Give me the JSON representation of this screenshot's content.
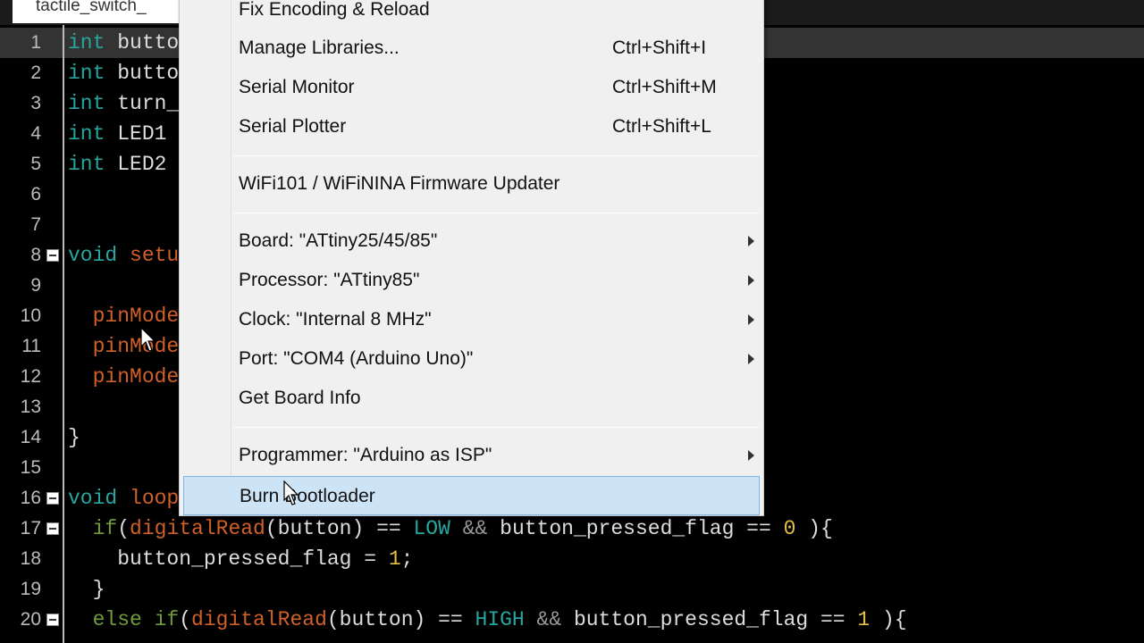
{
  "tab": {
    "title": "tactile_switch_"
  },
  "editor": {
    "lines": [
      {
        "n": "1",
        "fold": false,
        "hl": true,
        "t": [
          [
            "int",
            "kw"
          ],
          [
            " butto",
            "tx"
          ]
        ]
      },
      {
        "n": "2",
        "fold": false,
        "t": [
          [
            "int",
            "kw"
          ],
          [
            " butto",
            "tx"
          ]
        ]
      },
      {
        "n": "3",
        "fold": false,
        "t": [
          [
            "int",
            "kw"
          ],
          [
            " turn_",
            "tx"
          ]
        ]
      },
      {
        "n": "4",
        "fold": false,
        "t": [
          [
            "int",
            "kw"
          ],
          [
            " LED1",
            "tx"
          ]
        ]
      },
      {
        "n": "5",
        "fold": false,
        "t": [
          [
            "int",
            "kw"
          ],
          [
            " LED2",
            "tx"
          ]
        ]
      },
      {
        "n": "6",
        "fold": false,
        "t": []
      },
      {
        "n": "7",
        "fold": false,
        "t": []
      },
      {
        "n": "8",
        "fold": true,
        "t": [
          [
            "void",
            "kw"
          ],
          [
            " setu",
            "fn"
          ]
        ]
      },
      {
        "n": "9",
        "fold": false,
        "t": []
      },
      {
        "n": "10",
        "fold": false,
        "t": [
          [
            "  pinMode",
            "fn"
          ]
        ]
      },
      {
        "n": "11",
        "fold": false,
        "t": [
          [
            "  pinMode",
            "fn"
          ]
        ]
      },
      {
        "n": "12",
        "fold": false,
        "t": [
          [
            "  pinMode",
            "fn"
          ]
        ]
      },
      {
        "n": "13",
        "fold": false,
        "t": []
      },
      {
        "n": "14",
        "fold": false,
        "t": [
          [
            "}",
            "tx"
          ]
        ]
      },
      {
        "n": "15",
        "fold": false,
        "t": []
      },
      {
        "n": "16",
        "fold": true,
        "t": [
          [
            "void",
            "kw"
          ],
          [
            " loop",
            "fn"
          ]
        ]
      },
      {
        "n": "17",
        "fold": true,
        "t": [
          [
            "  if",
            "kw2"
          ],
          [
            "(",
            "tx"
          ],
          [
            "digitalRead",
            "fn"
          ],
          [
            "(button) == ",
            "tx"
          ],
          [
            "LOW",
            "ct"
          ],
          [
            " && ",
            "op"
          ],
          [
            "button_pressed_flag == ",
            "tx"
          ],
          [
            "0",
            "num"
          ],
          [
            " ){",
            "tx"
          ]
        ]
      },
      {
        "n": "18",
        "fold": false,
        "t": [
          [
            "    button_pressed_flag = ",
            "tx"
          ],
          [
            "1",
            "num"
          ],
          [
            ";",
            "tx"
          ]
        ]
      },
      {
        "n": "19",
        "fold": false,
        "t": [
          [
            "  }",
            "tx"
          ]
        ]
      },
      {
        "n": "20",
        "fold": true,
        "t": [
          [
            "  else if",
            "kw2"
          ],
          [
            "(",
            "tx"
          ],
          [
            "digitalRead",
            "fn"
          ],
          [
            "(button) == ",
            "tx"
          ],
          [
            "HIGH",
            "ct"
          ],
          [
            " && ",
            "op"
          ],
          [
            "button_pressed_flag == ",
            "tx"
          ],
          [
            "1",
            "num"
          ],
          [
            " ){",
            "tx"
          ]
        ]
      }
    ]
  },
  "menu": {
    "items": [
      {
        "label": "Fix Encoding & Reload"
      },
      {
        "label": "Manage Libraries...",
        "shortcut": "Ctrl+Shift+I"
      },
      {
        "label": "Serial Monitor",
        "shortcut": "Ctrl+Shift+M"
      },
      {
        "label": "Serial Plotter",
        "shortcut": "Ctrl+Shift+L"
      },
      {
        "sep": true
      },
      {
        "label": "WiFi101 / WiFiNINA Firmware Updater"
      },
      {
        "sep": true
      },
      {
        "label": "Board: \"ATtiny25/45/85\"",
        "submenu": true
      },
      {
        "label": "Processor: \"ATtiny85\"",
        "submenu": true
      },
      {
        "label": "Clock: \"Internal 8 MHz\"",
        "submenu": true
      },
      {
        "label": "Port: \"COM4 (Arduino Uno)\"",
        "submenu": true
      },
      {
        "label": "Get Board Info"
      },
      {
        "sep": true
      },
      {
        "label": "Programmer: \"Arduino as ISP\"",
        "submenu": true
      },
      {
        "label": "Burn Bootloader",
        "selected": true
      }
    ]
  },
  "colors": {
    "selection": "#cde4f7",
    "keyword": "#27a6a0",
    "function": "#d0602a",
    "number": "#e3c14a"
  }
}
